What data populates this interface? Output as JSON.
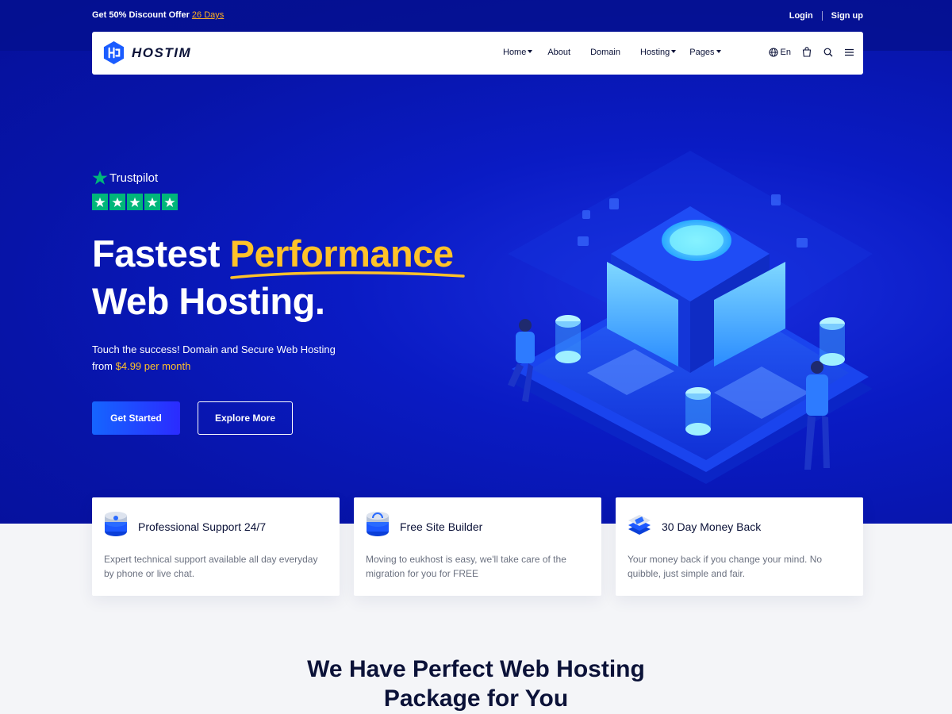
{
  "topbar": {
    "offer_text": "Get 50% Discount Offer",
    "offer_days": "26 Days",
    "login": "Login",
    "signup": "Sign up"
  },
  "brand": {
    "name": "HOSTIM"
  },
  "nav": {
    "items": [
      {
        "label": "Home",
        "dropdown": true
      },
      {
        "label": "About",
        "dropdown": false
      },
      {
        "label": "Domain",
        "dropdown": false
      },
      {
        "label": "Hosting",
        "dropdown": true
      },
      {
        "label": "Pages",
        "dropdown": true
      }
    ],
    "language": "En",
    "icons": [
      "globe-icon",
      "cart-icon",
      "search-icon",
      "menu-icon"
    ]
  },
  "hero": {
    "trustpilot_label": "Trustpilot",
    "rating_stars": 5,
    "headline_word1": "Fastest",
    "headline_highlight": "Performance",
    "headline_line2": "Web Hosting.",
    "subtext_line1": "Touch the success! Domain and Secure Web Hosting",
    "subtext_from": "from",
    "subtext_price": "$4.99 per month",
    "primary_button": "Get Started",
    "secondary_button": "Explore More"
  },
  "features": [
    {
      "icon": "support-server-icon",
      "title": "Professional Support 24/7",
      "text": "Expert technical support available all day everyday by phone or live chat."
    },
    {
      "icon": "site-builder-icon",
      "title": "Free Site Builder",
      "text": "Moving to eukhost is easy, we'll take care of the migration for you for FREE"
    },
    {
      "icon": "money-back-icon",
      "title": "30 Day Money Back",
      "text": "Your money back if you change your mind. No quibble, just simple and fair."
    }
  ],
  "section": {
    "title_line1": "We Have Perfect Web Hosting",
    "title_line2": "Package for You"
  },
  "colors": {
    "hero_blue": "#0714a8",
    "accent_yellow": "#ffc229",
    "trustpilot_green": "#00b67a",
    "primary_button": "#1565ff",
    "offer_orange": "#ffb020"
  }
}
